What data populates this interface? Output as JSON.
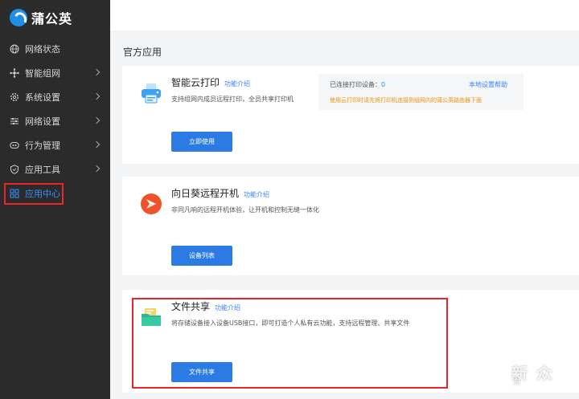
{
  "brand": {
    "name": "蒲公英",
    "logo_icon": "dandelion-logo-icon"
  },
  "sidebar": {
    "items": [
      {
        "label": "网络状态",
        "icon": "globe-icon",
        "has_chevron": false
      },
      {
        "label": "智能组网",
        "icon": "network-icon",
        "has_chevron": true
      },
      {
        "label": "系统设置",
        "icon": "gear-icon",
        "has_chevron": true
      },
      {
        "label": "网络设置",
        "icon": "sliders-icon",
        "has_chevron": true
      },
      {
        "label": "行为管理",
        "icon": "behavior-icon",
        "has_chevron": true
      },
      {
        "label": "应用工具",
        "icon": "shield-icon",
        "has_chevron": true
      },
      {
        "label": "应用中心",
        "icon": "grid-icon",
        "has_chevron": false,
        "active": true
      }
    ]
  },
  "main": {
    "section_title": "官方应用",
    "cards": [
      {
        "title": "智能云打印",
        "link": "功能介绍",
        "desc": "支持组网内成员远程打印，全员共享打印机",
        "button": "立即使用",
        "icon": "printer-icon",
        "info": {
          "connected_label": "已连接打印设备：",
          "connected_count": "0",
          "help": "本地设置帮助",
          "warning": "使用云打印时请先将打印机连接到组网内的蒲公英路由器下面"
        }
      },
      {
        "title": "向日葵远程开机",
        "link": "功能介绍",
        "desc": "非同凡响的远程开机体验，让开机和控制无缝一体化",
        "button": "设备列表",
        "icon": "sunflower-icon"
      },
      {
        "title": "文件共享",
        "link": "功能介绍",
        "desc": "将存储设备接入设备USB接口，即可打造个人私有云功能，支持远程管理、共享文件",
        "button": "文件共享",
        "icon": "folder-icon"
      }
    ]
  },
  "watermark": {
    "big": "新  众",
    "small": "浪"
  },
  "colors": {
    "accent": "#2c7be5",
    "sidebar_bg": "#2b2b2b",
    "highlight": "#e8262b",
    "warning": "#f0930a"
  }
}
